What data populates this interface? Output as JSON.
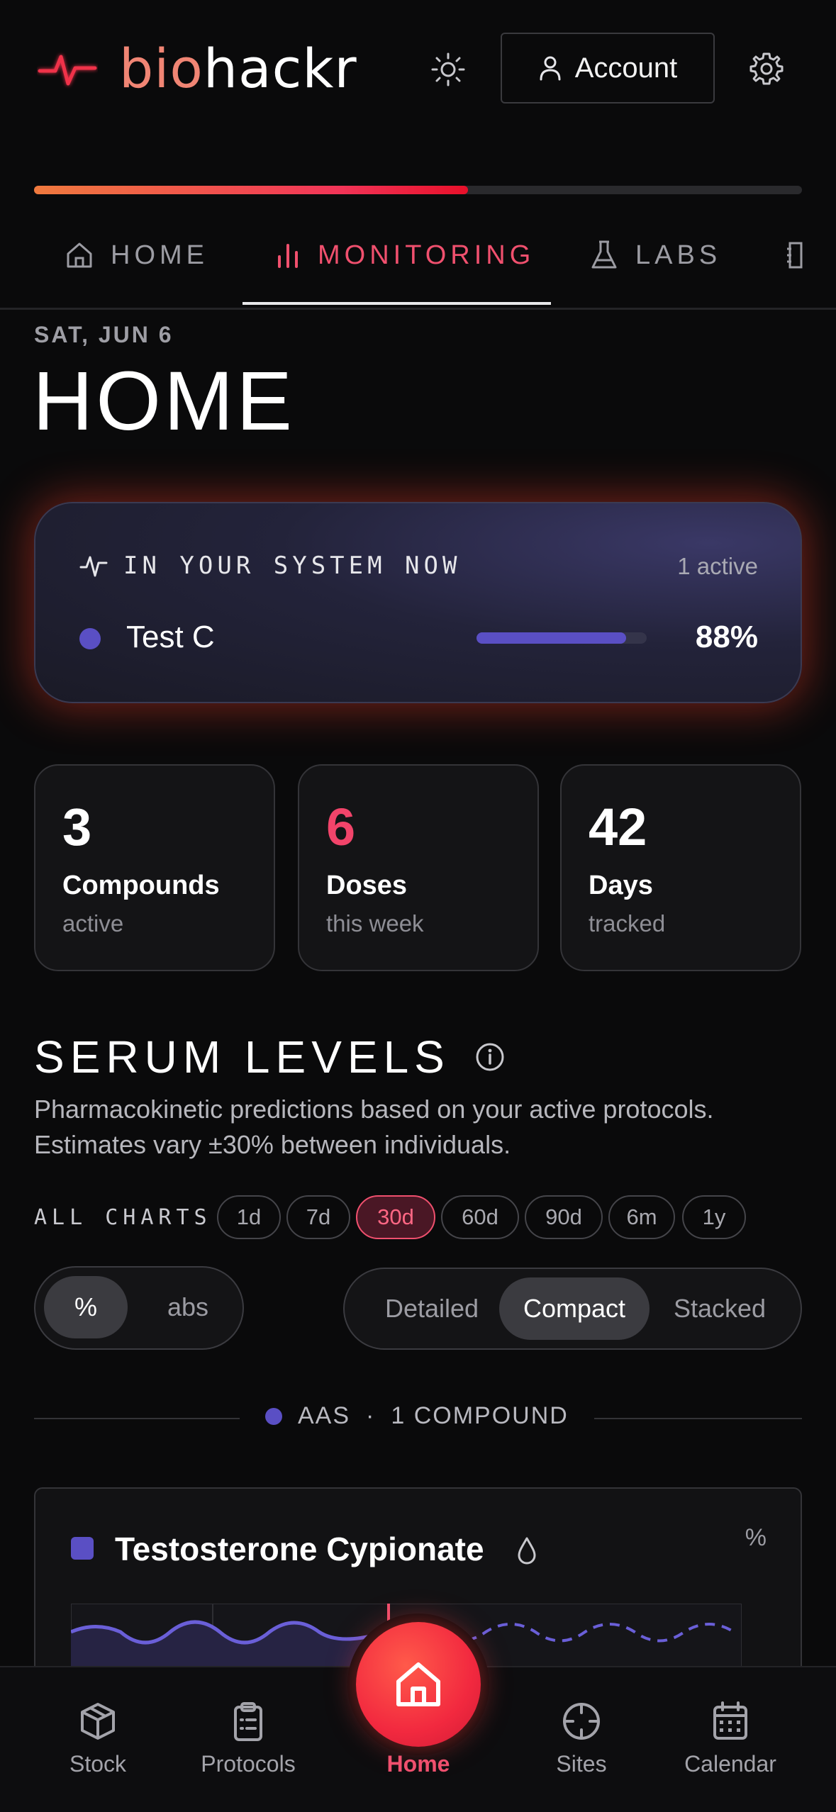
{
  "header": {
    "logo_part1": "bio",
    "logo_part2": "hackr",
    "account_label": "Account"
  },
  "progress": {
    "value": 0.565
  },
  "tabs": [
    {
      "label": "HOME",
      "icon": "home-icon"
    },
    {
      "label": "MONITORING",
      "icon": "bar-chart-icon",
      "active": true
    },
    {
      "label": "LABS",
      "icon": "flask-icon"
    },
    {
      "label": "",
      "icon": "book-icon"
    }
  ],
  "page": {
    "date": "SAT, JUN 6",
    "title": "HOME"
  },
  "system": {
    "heading": "IN YOUR SYSTEM NOW",
    "count": "1 active",
    "items": [
      {
        "name": "Test C",
        "percent": "88%",
        "level": 0.88,
        "color": "#5a4fc4"
      }
    ]
  },
  "stats": [
    {
      "value": "3",
      "label": "Compounds",
      "sub": "active"
    },
    {
      "value": "6",
      "label": "Doses",
      "sub": "this week",
      "accent": true
    },
    {
      "value": "42",
      "label": "Days",
      "sub": "tracked"
    }
  ],
  "serum": {
    "title": "SERUM LEVELS",
    "desc_line1": "Pharmacokinetic predictions based on your active protocols.",
    "desc_line2": "Estimates vary ±30% between individuals.",
    "all_charts_label": "ALL CHARTS",
    "ranges": [
      "1d",
      "7d",
      "30d",
      "60d",
      "90d",
      "6m",
      "1y"
    ],
    "selected_range": "30d",
    "units": [
      "%",
      "abs"
    ],
    "selected_unit": "%",
    "views": [
      "Detailed",
      "Compact",
      "Stacked"
    ],
    "selected_view": "Compact"
  },
  "group": {
    "name": "AAS",
    "separator": "·",
    "count": "1 COMPOUND"
  },
  "compound": {
    "name": "Testosterone Cypionate",
    "unit": "%",
    "color": "#5a4fc4"
  },
  "nav": [
    {
      "label": "Stock",
      "icon": "box-icon"
    },
    {
      "label": "Protocols",
      "icon": "clipboard-icon"
    },
    {
      "label": "Home",
      "icon": "home-icon",
      "active": true
    },
    {
      "label": "Sites",
      "icon": "crosshair-icon"
    },
    {
      "label": "Calendar",
      "icon": "calendar-icon"
    }
  ],
  "colors": {
    "accent": "#f0506e",
    "compound": "#5a4fc4",
    "background": "#0a0a0b"
  }
}
